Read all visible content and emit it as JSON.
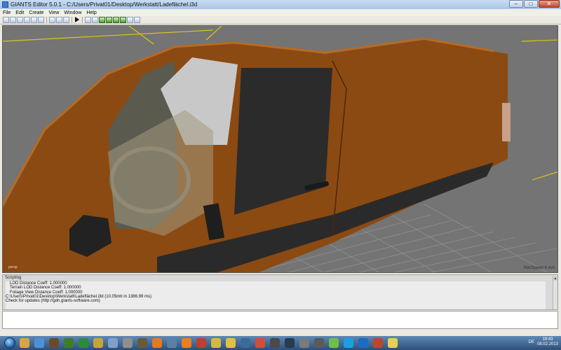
{
  "window": {
    "title": "GIANTS Editor 5.0.1 - C:/Users/Privat01/Desktop/Werkstatt/Ladeflächel.i3d",
    "minimize": "–",
    "maximize": "□",
    "close": "✕"
  },
  "menu": [
    {
      "label": "File"
    },
    {
      "label": "Edit"
    },
    {
      "label": "Create"
    },
    {
      "label": "View"
    },
    {
      "label": "Window"
    },
    {
      "label": "Help"
    }
  ],
  "viewport": {
    "camera_label": "persp",
    "nav_label": "NavSpeed 4 m/s",
    "colors": {
      "background": "#747474",
      "body_paint": "#8b4a12",
      "body_highlight": "#b86a22",
      "glass": "#2b2b2b",
      "floor_grid": "#9a9a9a",
      "axis_yellow": "#d9c51e"
    }
  },
  "scripting": {
    "title": "Scripting",
    "lines": [
      "LOD Distance Coeff: 1.000000",
      "Terrain LOD Distance Coeff: 1.000000",
      "Foliage View Distance Coeff: 1.000000",
      "C:\\Users\\Privat01\\Desktop\\Werkstatt\\Ladeflächel.i3d (10.05mb in 1386.99 ms)",
      "Check for updates (http://gdn.giants-software.com)"
    ]
  },
  "taskbar": {
    "lang": "DE",
    "time": "19:43",
    "date": "08.02.2013",
    "icons": [
      {
        "name": "folder-icon",
        "color": "#d9a441"
      },
      {
        "name": "explorer-icon",
        "color": "#4f8fd6"
      },
      {
        "name": "game-icon",
        "color": "#6b4a2c"
      },
      {
        "name": "tractor-icon",
        "color": "#3f7d2a"
      },
      {
        "name": "excel-icon",
        "color": "#2c8a3e"
      },
      {
        "name": "ftp-icon",
        "color": "#c8a23a"
      },
      {
        "name": "editor-icon",
        "color": "#7fa0c8"
      },
      {
        "name": "tool-icon",
        "color": "#8f8f8f"
      },
      {
        "name": "gimp-icon",
        "color": "#6a5a3a"
      },
      {
        "name": "blender-icon",
        "color": "#e07b1e"
      },
      {
        "name": "network-icon",
        "color": "#5d7fa6"
      },
      {
        "name": "vlc-icon",
        "color": "#f07c1a"
      },
      {
        "name": "media-icon",
        "color": "#c43b2f"
      },
      {
        "name": "browser-icon",
        "color": "#d4b93a"
      },
      {
        "name": "counter-icon",
        "color": "#e3c13b"
      },
      {
        "name": "vpn-icon",
        "color": "#3c6a9a"
      },
      {
        "name": "chrome-icon",
        "color": "#d94a3a"
      },
      {
        "name": "app-icon",
        "color": "#4a4a4a"
      },
      {
        "name": "steam-icon",
        "color": "#2a3a4f"
      },
      {
        "name": "player-icon",
        "color": "#7a7a7a"
      },
      {
        "name": "settings-icon",
        "color": "#5a5a5a"
      },
      {
        "name": "icq-icon",
        "color": "#6cc04a"
      },
      {
        "name": "skype-icon",
        "color": "#1aa0e0"
      },
      {
        "name": "teamviewer-icon",
        "color": "#1d6cc4"
      },
      {
        "name": "photo-icon",
        "color": "#c0452a"
      },
      {
        "name": "notes-icon",
        "color": "#e5d24a"
      }
    ]
  }
}
